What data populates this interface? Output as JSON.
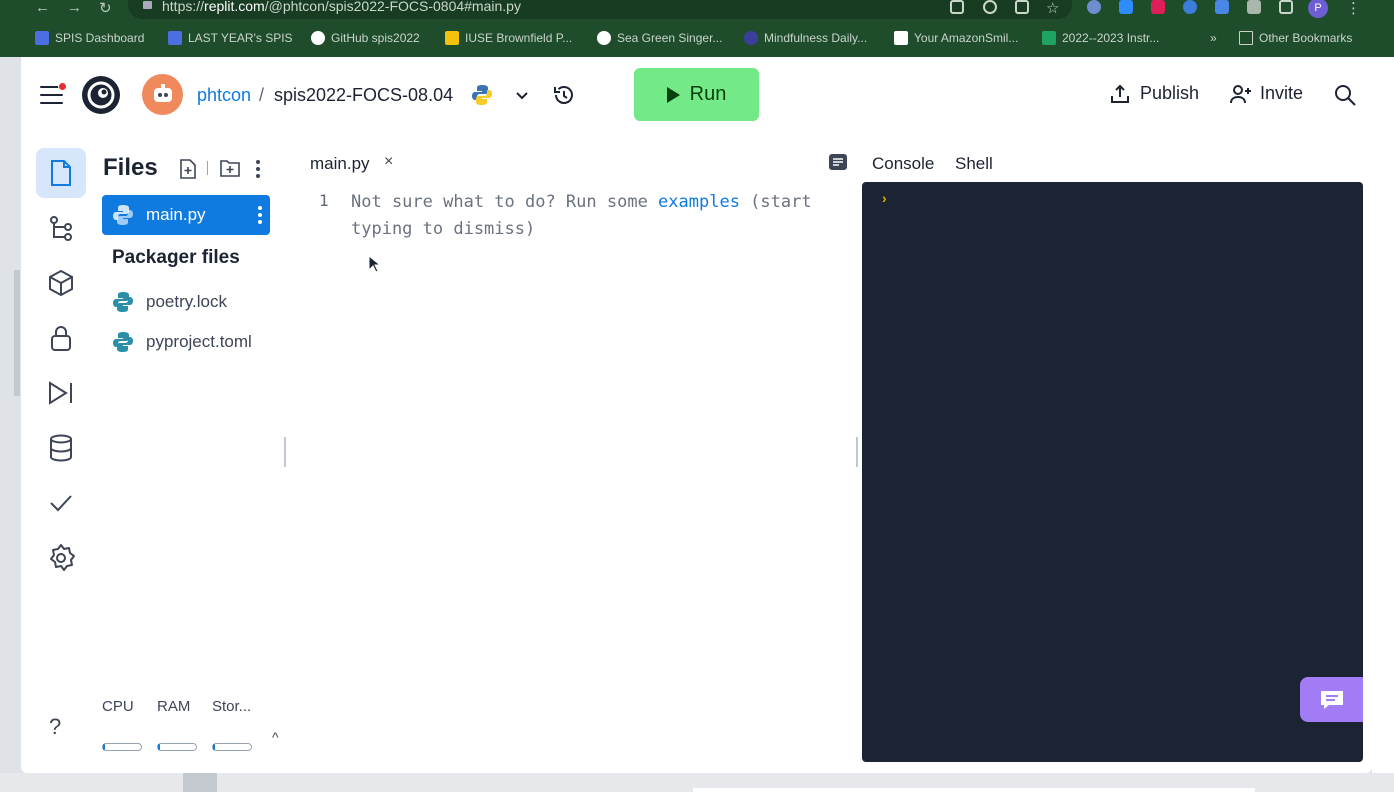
{
  "browser": {
    "url_prefix": "https://",
    "url_domain": "replit.com",
    "url_path": "/@phtcon/spis2022-FOCS-0804#main.py",
    "bookmarks": [
      {
        "label": "SPIS Dashboard",
        "color": "#4b6fe0"
      },
      {
        "label": "LAST YEAR's SPIS",
        "color": "#4b6fe0"
      },
      {
        "label": "GitHub spis2022",
        "color": "#ffffff"
      },
      {
        "label": "IUSE Brownfield P...",
        "color": "#f4c20d"
      },
      {
        "label": "Sea Green Singer...",
        "color": "#ffffff"
      },
      {
        "label": "Mindfulness Daily...",
        "color": "#3b3f9b"
      },
      {
        "label": "Your AmazonSmil...",
        "color": "#ffffff"
      },
      {
        "label": "2022--2023 Instr...",
        "color": "#1ea362"
      }
    ],
    "bookmarks_more": "»",
    "other_bookmarks": "Other Bookmarks",
    "profile_initial": "P"
  },
  "header": {
    "username": "phtcon",
    "separator": "/",
    "repl_name": "spis2022-FOCS-08.04",
    "run_label": "Run",
    "publish_label": "Publish",
    "invite_label": "Invite"
  },
  "files": {
    "title": "Files",
    "items": [
      {
        "name": "main.py"
      }
    ],
    "packager_title": "Packager files",
    "packager_items": [
      {
        "name": "poetry.lock"
      },
      {
        "name": "pyproject.toml"
      }
    ]
  },
  "editor": {
    "tab_label": "main.py",
    "tab_close": "×",
    "line_number": "1",
    "placeholder_before": "Not sure what to do? Run some ",
    "placeholder_link": "examples",
    "placeholder_after": " (start typing to dismiss)"
  },
  "panel": {
    "tabs": [
      {
        "label": "Console"
      },
      {
        "label": "Shell"
      }
    ],
    "prompt": "›"
  },
  "resources": {
    "help": "?",
    "items": [
      {
        "label": "CPU",
        "usage": 0.03
      },
      {
        "label": "RAM",
        "usage": 0.05
      },
      {
        "label": "Stor...",
        "usage": 0.03
      }
    ],
    "toggle": "^"
  },
  "colors": {
    "accent": "#0f7be0",
    "run_button": "#73ea87",
    "console_bg": "#1c2333",
    "chat_button": "#a27cf5"
  }
}
